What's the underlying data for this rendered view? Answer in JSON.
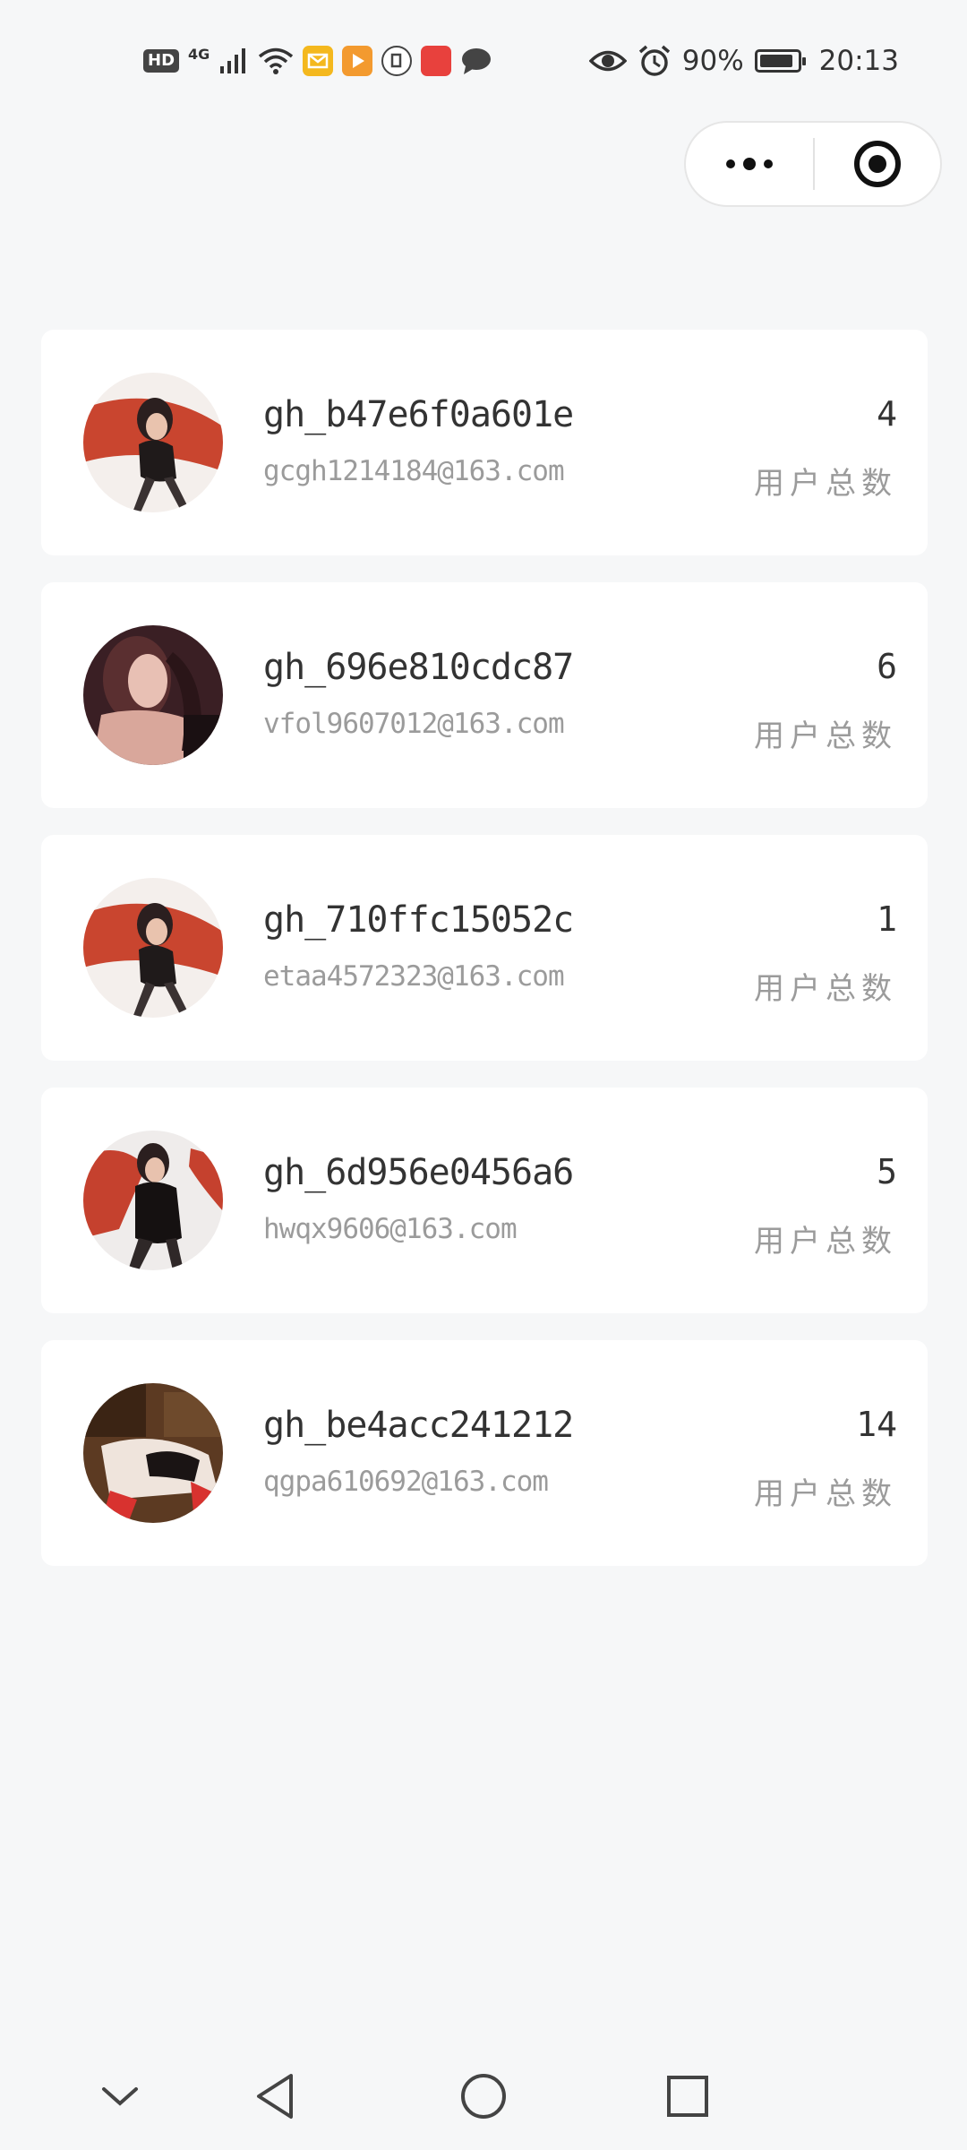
{
  "status_bar": {
    "hd": "HD",
    "network": "4G",
    "battery_percent": "90%",
    "battery_level": 0.9,
    "time": "20:13",
    "icons": [
      "signal-icon",
      "wifi-icon",
      "mail-app-icon",
      "video-app-icon",
      "shield-app-icon",
      "huawei-app-icon",
      "message-app-icon",
      "eye-icon",
      "alarm-icon",
      "battery-icon"
    ]
  },
  "capsule": {
    "icons": [
      "more-dots-icon",
      "close-target-icon"
    ]
  },
  "accounts": [
    {
      "name": "gh_b47e6f0a601e",
      "email": "gcgh1214184@163.com",
      "count": "4",
      "count_label": "用户总数"
    },
    {
      "name": "gh_696e810cdc87",
      "email": "vfol9607012@163.com",
      "count": "6",
      "count_label": "用户总数"
    },
    {
      "name": "gh_710ffc15052c",
      "email": "etaa4572323@163.com",
      "count": "1",
      "count_label": "用户总数"
    },
    {
      "name": "gh_6d956e0456a6",
      "email": "hwqx9606@163.com",
      "count": "5",
      "count_label": "用户总数"
    },
    {
      "name": "gh_be4acc241212",
      "email": "qgpa610692@163.com",
      "count": "14",
      "count_label": "用户总数"
    }
  ],
  "nav_bar": {
    "icons": [
      "collapse-chevron-icon",
      "back-triangle-icon",
      "home-circle-icon",
      "recents-square-icon"
    ]
  },
  "colors": {
    "background": "#f6f7f8",
    "card": "#ffffff",
    "primary_text": "#333333",
    "secondary_text": "#9b9b9b"
  }
}
